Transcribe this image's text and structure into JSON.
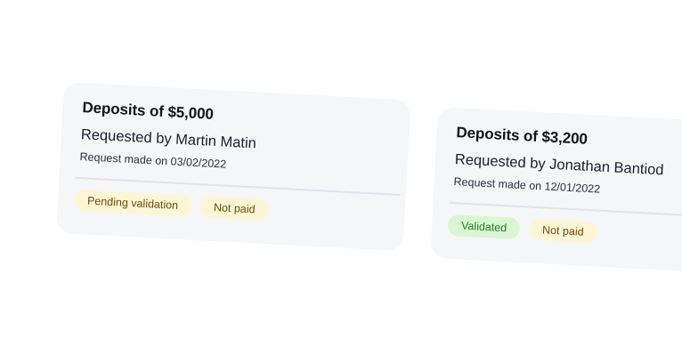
{
  "cards": [
    {
      "title": "Deposits of $5,000",
      "requester": "Requested by Martin Matin",
      "date": "Request made on 03/02/2022",
      "badges": [
        {
          "label": "Pending validation",
          "color": "#fdf6d6"
        },
        {
          "label": "Not paid",
          "color": "#fdf6d6"
        }
      ]
    },
    {
      "title": "Deposits of $3,200",
      "requester": "Requested by Jonathan Bantiod",
      "date": "Request made on 12/01/2022",
      "badges": [
        {
          "label": "Validated",
          "color": "#d8f7d2"
        },
        {
          "label": "Not paid",
          "color": "#fdf6d6"
        }
      ]
    }
  ]
}
